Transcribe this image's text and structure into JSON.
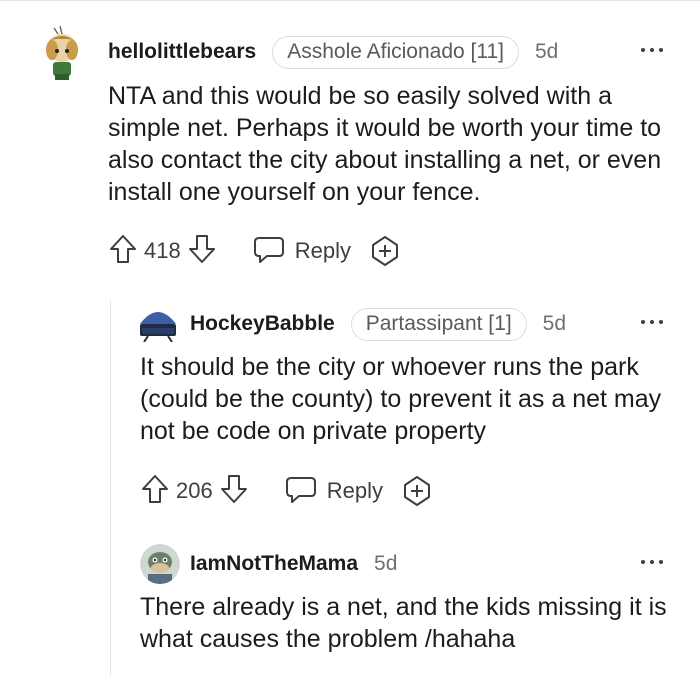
{
  "comments": [
    {
      "username": "hellolittlebears",
      "flair": "Asshole Aficionado [11]",
      "age": "5d",
      "text": "NTA and this would be so easily solved with a simple net. Perhaps it would be worth your time to also contact the city about installing a net, or even install one yourself on your fence.",
      "score": "418",
      "reply_label": "Reply"
    },
    {
      "username": "HockeyBabble",
      "flair": "Partassipant [1]",
      "age": "5d",
      "text": "It should be the city or whoever runs the park (could be the county) to prevent it as a net may not be code on private property",
      "score": "206",
      "reply_label": "Reply"
    },
    {
      "username": "IamNotTheMama",
      "age": "5d",
      "text": "There already is a net, and the kids missing it is what causes the problem /hahaha"
    }
  ],
  "icons": {
    "upvote": "arrow-up-icon",
    "downvote": "arrow-down-icon",
    "reply": "speech-bubble-icon",
    "award": "award-plus-icon",
    "more": "ellipsis-icon"
  },
  "colors": {
    "text": "#1c1c1c",
    "muted": "#6b7176",
    "flair_border": "#d9dde0"
  }
}
